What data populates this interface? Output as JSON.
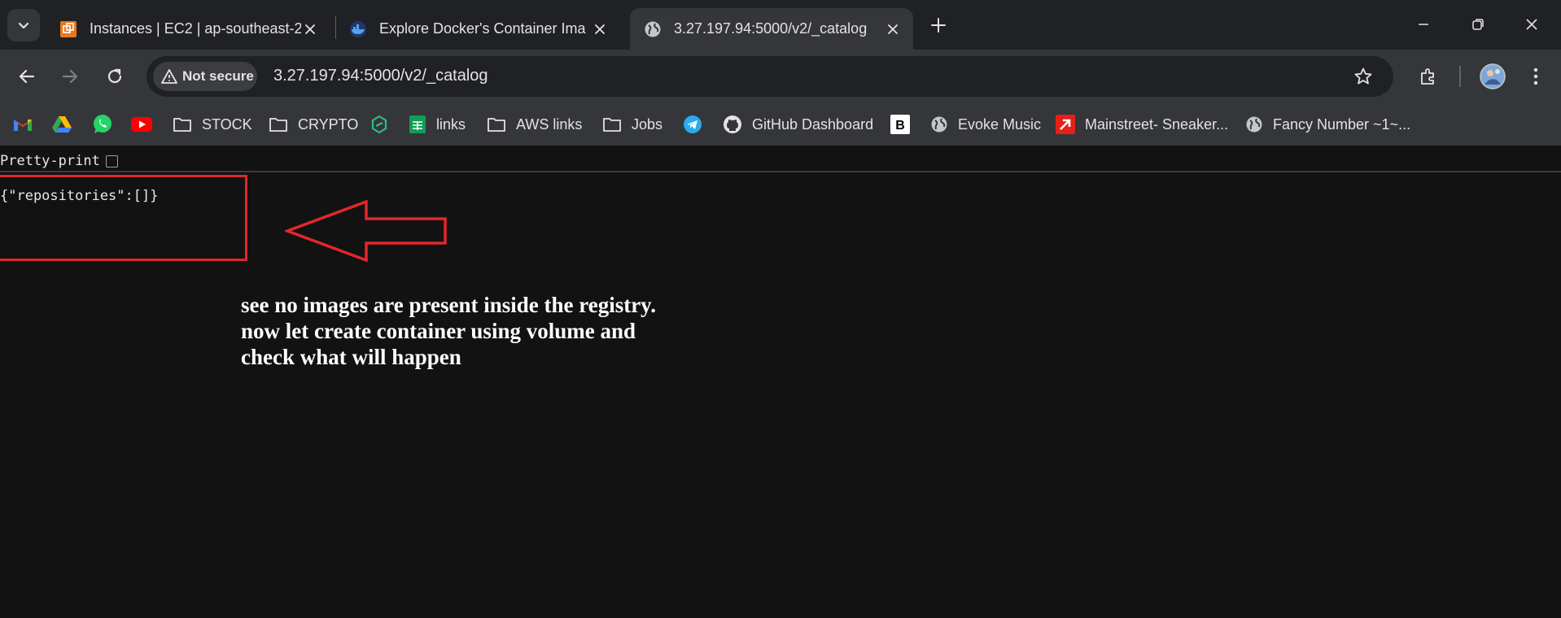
{
  "browser": {
    "tabs": [
      {
        "title": "Instances | EC2 | ap-southeast-2",
        "icon": "aws-ec2-icon",
        "active": false
      },
      {
        "title": "Explore Docker's Container Ima",
        "icon": "docker-icon",
        "active": false
      },
      {
        "title": "3.27.197.94:5000/v2/_catalog",
        "icon": "globe-icon",
        "active": true
      }
    ],
    "security_chip": "Not secure",
    "url": "3.27.197.94:5000/v2/_catalog",
    "bookmarks": [
      {
        "label": "",
        "icon": "gmail-icon"
      },
      {
        "label": "",
        "icon": "google-drive-icon"
      },
      {
        "label": "",
        "icon": "whatsapp-icon"
      },
      {
        "label": "",
        "icon": "youtube-icon"
      },
      {
        "label": "STOCK",
        "icon": "folder-icon"
      },
      {
        "label": "CRYPTO",
        "icon": "folder-icon"
      },
      {
        "label": "",
        "icon": "crypto-site-icon"
      },
      {
        "label": "links",
        "icon": "google-sheets-icon"
      },
      {
        "label": "AWS links",
        "icon": "folder-icon"
      },
      {
        "label": "Jobs",
        "icon": "folder-icon"
      },
      {
        "label": "",
        "icon": "telegram-icon"
      },
      {
        "label": "GitHub Dashboard",
        "icon": "github-icon"
      },
      {
        "label": "",
        "icon": "b-logo-icon"
      },
      {
        "label": "Evoke Music",
        "icon": "globe-icon"
      },
      {
        "label": "Mainstreet- Sneaker...",
        "icon": "mainstreet-icon"
      },
      {
        "label": "Fancy Number ~1~...",
        "icon": "globe-icon"
      }
    ]
  },
  "page": {
    "pretty_print_label": "Pretty-print",
    "pretty_print_checked": false,
    "json_text": "{\"repositories\":[]}",
    "annotation_lines": [
      "see no images are present inside the registry.",
      "now let create container using volume and",
      "check what will happen"
    ],
    "annotation_color": "#e3262b"
  }
}
